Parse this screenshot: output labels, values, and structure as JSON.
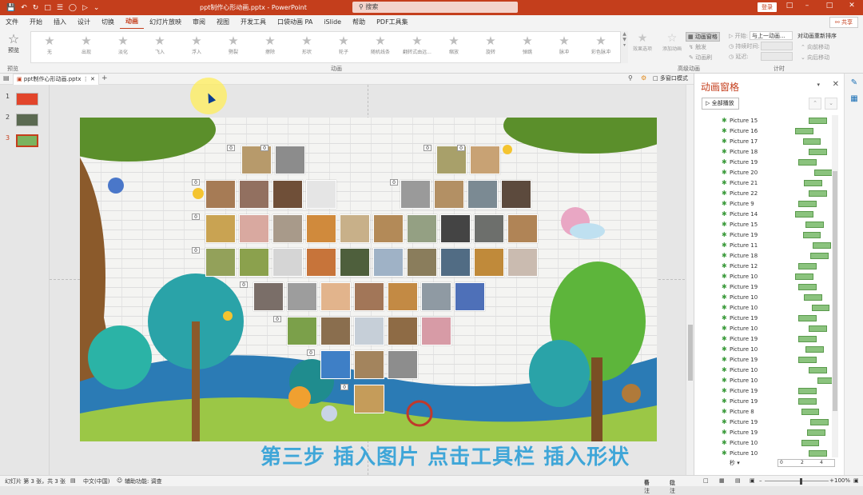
{
  "titlebar": {
    "doc_title": "ppt制作心形动画.pptx - PowerPoint",
    "search_placeholder": "搜索",
    "login": "登录"
  },
  "menu": {
    "tabs": [
      "文件",
      "开始",
      "插入",
      "设计",
      "切换",
      "动画",
      "幻灯片放映",
      "审阅",
      "视图",
      "开发工具",
      "口袋动画 PA",
      "iSlide",
      "帮助",
      "PDF工具集"
    ],
    "active": "动画",
    "share": "共享"
  },
  "ribbon": {
    "preview": "预览",
    "preview_group": "预览",
    "animation_group": "动画",
    "advanced_group": "高级动画",
    "timing_group": "计时",
    "effects": [
      "无",
      "出现",
      "淡化",
      "飞入",
      "浮入",
      "劈裂",
      "擦除",
      "形状",
      "轮子",
      "随机线条",
      "翻转式由远...",
      "缩放",
      "旋转",
      "弹跳",
      "脉冲",
      "彩色脉冲"
    ],
    "effect_options": "效果选项",
    "add_animation": "添加动画",
    "animation_pane": "动画窗格",
    "trigger": "触发",
    "animation_painter": "动画刷",
    "start_label": "开始:",
    "start_value": "与上一动画...",
    "duration_label": "持续时间:",
    "delay_label": "延迟:",
    "reorder": "对动画重新排序",
    "move_earlier": "向前移动",
    "move_later": "向后移动"
  },
  "doctab": {
    "name": "ppt制作心形动画.pptx",
    "multi_window": "多窗口模式"
  },
  "thumbnails": [
    {
      "num": "1",
      "color": "#e2452b"
    },
    {
      "num": "2",
      "color": "#5b6a52"
    },
    {
      "num": "3",
      "color": "#7bb35f",
      "active": true
    }
  ],
  "slide": {
    "caption": "第三步 插入图片 点击工具栏 插入形状",
    "badge": "0"
  },
  "pane": {
    "title": "动画窗格",
    "play_all": "全部播放",
    "items": [
      {
        "name": "Picture 15",
        "start": 0.38,
        "len": 0.16
      },
      {
        "name": "Picture 16",
        "start": 0.2,
        "len": 0.16
      },
      {
        "name": "Picture 17",
        "start": 0.3,
        "len": 0.16
      },
      {
        "name": "Picture 18",
        "start": 0.38,
        "len": 0.16
      },
      {
        "name": "Picture 19",
        "start": 0.24,
        "len": 0.16
      },
      {
        "name": "Picture 20",
        "start": 0.46,
        "len": 0.16
      },
      {
        "name": "Picture 21",
        "start": 0.32,
        "len": 0.16
      },
      {
        "name": "Picture 22",
        "start": 0.38,
        "len": 0.16
      },
      {
        "name": "Picture 9",
        "start": 0.24,
        "len": 0.16
      },
      {
        "name": "Picture 14",
        "start": 0.2,
        "len": 0.16
      },
      {
        "name": "Picture 15",
        "start": 0.34,
        "len": 0.16
      },
      {
        "name": "Picture 19",
        "start": 0.3,
        "len": 0.16
      },
      {
        "name": "Picture 11",
        "start": 0.44,
        "len": 0.16
      },
      {
        "name": "Picture 18",
        "start": 0.4,
        "len": 0.16
      },
      {
        "name": "Picture 12",
        "start": 0.24,
        "len": 0.16
      },
      {
        "name": "Picture 10",
        "start": 0.2,
        "len": 0.16
      },
      {
        "name": "Picture 19",
        "start": 0.24,
        "len": 0.16
      },
      {
        "name": "Picture 10",
        "start": 0.32,
        "len": 0.16
      },
      {
        "name": "Picture 10",
        "start": 0.42,
        "len": 0.16
      },
      {
        "name": "Picture 19",
        "start": 0.24,
        "len": 0.16
      },
      {
        "name": "Picture 10",
        "start": 0.38,
        "len": 0.16
      },
      {
        "name": "Picture 19",
        "start": 0.24,
        "len": 0.16
      },
      {
        "name": "Picture 10",
        "start": 0.34,
        "len": 0.16
      },
      {
        "name": "Picture 19",
        "start": 0.24,
        "len": 0.16
      },
      {
        "name": "Picture 10",
        "start": 0.38,
        "len": 0.16
      },
      {
        "name": "Picture 10",
        "start": 0.5,
        "len": 0.16
      },
      {
        "name": "Picture 19",
        "start": 0.24,
        "len": 0.16
      },
      {
        "name": "Picture 19",
        "start": 0.24,
        "len": 0.16
      },
      {
        "name": "Picture 8",
        "start": 0.28,
        "len": 0.16
      },
      {
        "name": "Picture 19",
        "start": 0.4,
        "len": 0.16
      },
      {
        "name": "Picture 19",
        "start": 0.36,
        "len": 0.16
      },
      {
        "name": "Picture 10",
        "start": 0.28,
        "len": 0.16
      },
      {
        "name": "Picture 10",
        "start": 0.38,
        "len": 0.16
      }
    ],
    "seconds_label": "秒",
    "timeline_ticks": [
      "0",
      "2",
      "4"
    ]
  },
  "status": {
    "slide_info": "幻灯片 第 3 张，共 3 张",
    "language": "中文(中国)",
    "accessibility": "辅助功能: 调查",
    "notes": "备注",
    "comments": "批注",
    "zoom": "100%"
  }
}
